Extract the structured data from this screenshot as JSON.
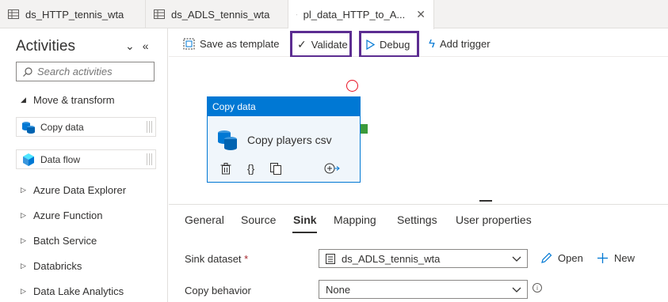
{
  "tabs": [
    {
      "label": "ds_HTTP_tennis_wta",
      "icon": "table-icon"
    },
    {
      "label": "ds_ADLS_tennis_wta",
      "icon": "table-icon"
    },
    {
      "label": "pl_data_HTTP_to_A...",
      "icon": "pipeline-icon",
      "active": true
    }
  ],
  "activities": {
    "title": "Activities",
    "search_placeholder": "Search activities",
    "group_open": "Move & transform",
    "items": [
      "Copy data",
      "Data flow"
    ],
    "categories": [
      "Azure Data Explorer",
      "Azure Function",
      "Batch Service",
      "Databricks",
      "Data Lake Analytics"
    ]
  },
  "toolbar": {
    "save_template": "Save as template",
    "validate": "Validate",
    "debug": "Debug",
    "add_trigger": "Add trigger"
  },
  "node": {
    "type": "Copy data",
    "name": "Copy players csv"
  },
  "properties": {
    "tabs": [
      "General",
      "Source",
      "Sink",
      "Mapping",
      "Settings",
      "User properties"
    ],
    "active_tab": "Sink",
    "sink_dataset_label": "Sink dataset",
    "required_mark": "*",
    "sink_dataset_value": "ds_ADLS_tennis_wta",
    "open_label": "Open",
    "new_label": "New",
    "copy_behavior_label": "Copy behavior",
    "copy_behavior_value": "None"
  },
  "colors": {
    "accent": "#0078d4",
    "highlight_box": "#5c2d91",
    "error_circle": "#e81123",
    "success_port": "#3b9a3b"
  }
}
